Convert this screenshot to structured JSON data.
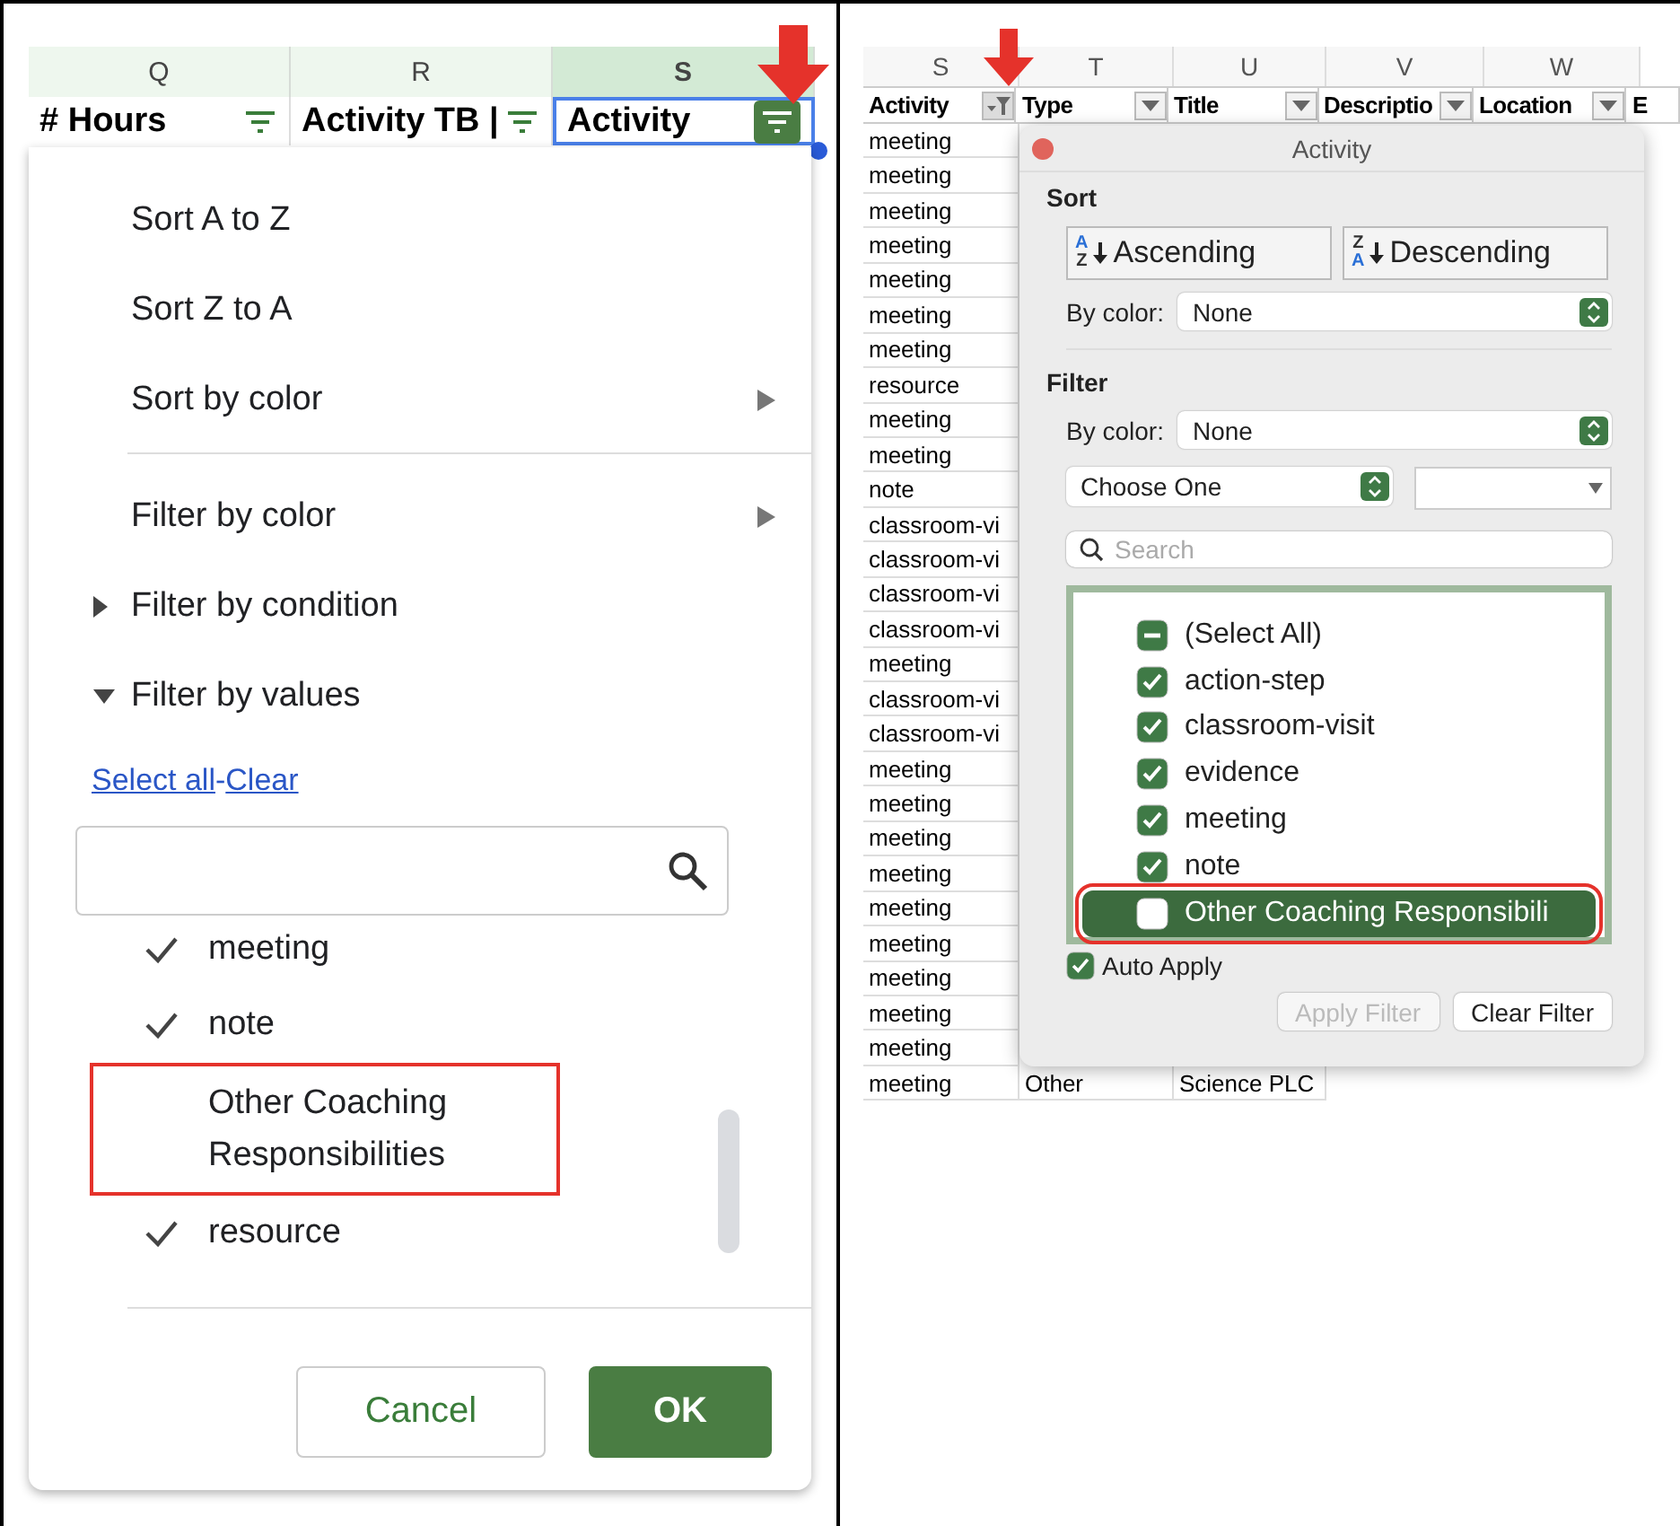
{
  "left": {
    "columns": [
      {
        "letter": "Q",
        "selected": false
      },
      {
        "letter": "R",
        "selected": false
      },
      {
        "letter": "S",
        "selected": true
      }
    ],
    "header_cells": [
      {
        "text": "# Hours",
        "selected": false
      },
      {
        "text": "Activity TB |",
        "selected": false
      },
      {
        "text": "Activity",
        "selected": true
      }
    ],
    "menu": {
      "sort_items": [
        {
          "label": "Sort A to Z",
          "submenu": false
        },
        {
          "label": "Sort Z to A",
          "submenu": false
        },
        {
          "label": "Sort by color",
          "submenu": true
        }
      ],
      "filter_items": [
        {
          "label": "Filter by color",
          "kind": "submenu"
        },
        {
          "label": "Filter by condition",
          "kind": "section",
          "expanded": false
        },
        {
          "label": "Filter by values",
          "kind": "section",
          "expanded": true
        }
      ],
      "select_all_link": "Select all",
      "separator": "-",
      "clear_link": "Clear",
      "values": [
        {
          "label": "meeting",
          "checked": true,
          "highlighted": false
        },
        {
          "label": "note",
          "checked": true,
          "highlighted": false
        },
        {
          "label": "Other Coaching Responsibilities",
          "checked": false,
          "highlighted": true
        },
        {
          "label": "resource",
          "checked": true,
          "highlighted": false
        }
      ],
      "cancel_button": "Cancel",
      "ok_button": "OK"
    }
  },
  "right": {
    "columns": [
      {
        "letter": "S",
        "header": "Activity",
        "filtered": true
      },
      {
        "letter": "T",
        "header": "Type",
        "filtered": false
      },
      {
        "letter": "U",
        "header": "Title",
        "filtered": false
      },
      {
        "letter": "V",
        "header": "Descriptio",
        "filtered": false
      },
      {
        "letter": "W",
        "header": "Location",
        "filtered": false
      },
      {
        "header": "E"
      }
    ],
    "rows": [
      [
        "meeting"
      ],
      [
        "meeting"
      ],
      [
        "meeting"
      ],
      [
        "meeting"
      ],
      [
        "meeting"
      ],
      [
        "meeting"
      ],
      [
        "meeting"
      ],
      [
        "resource"
      ],
      [
        "meeting"
      ],
      [
        "meeting"
      ],
      [
        "note"
      ],
      [
        "classroom-vi"
      ],
      [
        "classroom-vi"
      ],
      [
        "classroom-vi"
      ],
      [
        "classroom-vi"
      ],
      [
        "meeting"
      ],
      [
        "classroom-vi"
      ],
      [
        "classroom-vi"
      ],
      [
        "meeting"
      ],
      [
        "meeting"
      ],
      [
        "meeting"
      ],
      [
        "meeting"
      ],
      [
        "meeting"
      ],
      [
        "meeting"
      ],
      [
        "meeting"
      ],
      [
        "meeting"
      ],
      [
        "meeting"
      ],
      [
        "meeting",
        "Other",
        "Science PLC"
      ]
    ],
    "dialog": {
      "title": "Activity",
      "sort_label": "Sort",
      "sort_buttons": [
        {
          "label": "Ascending",
          "icon_top": "A",
          "icon_bottom": "Z"
        },
        {
          "label": "Descending",
          "icon_top": "Z",
          "icon_bottom": "A"
        }
      ],
      "sort_color_label": "By color:",
      "sort_color_value": "None",
      "filter_label": "Filter",
      "filter_color_label": "By color:",
      "filter_color_value": "None",
      "condition_value": "Choose One",
      "search_placeholder": "Search",
      "values": [
        {
          "label": "(Select All)",
          "checked": false,
          "mixed": true,
          "selected": false,
          "highlighted": false
        },
        {
          "label": "action-step",
          "checked": true,
          "mixed": false,
          "selected": false,
          "highlighted": false
        },
        {
          "label": "classroom-visit",
          "checked": true,
          "mixed": false,
          "selected": false,
          "highlighted": false
        },
        {
          "label": "evidence",
          "checked": true,
          "mixed": false,
          "selected": false,
          "highlighted": false
        },
        {
          "label": "meeting",
          "checked": true,
          "mixed": false,
          "selected": false,
          "highlighted": false
        },
        {
          "label": "note",
          "checked": true,
          "mixed": false,
          "selected": false,
          "highlighted": false
        },
        {
          "label": "Other Coaching Responsibili",
          "checked": false,
          "mixed": false,
          "selected": true,
          "highlighted": true
        }
      ],
      "auto_apply": {
        "label": "Auto Apply",
        "checked": true
      },
      "apply_button": {
        "label": "Apply Filter",
        "disabled": true
      },
      "clear_button": {
        "label": "Clear Filter",
        "disabled": false
      }
    }
  }
}
